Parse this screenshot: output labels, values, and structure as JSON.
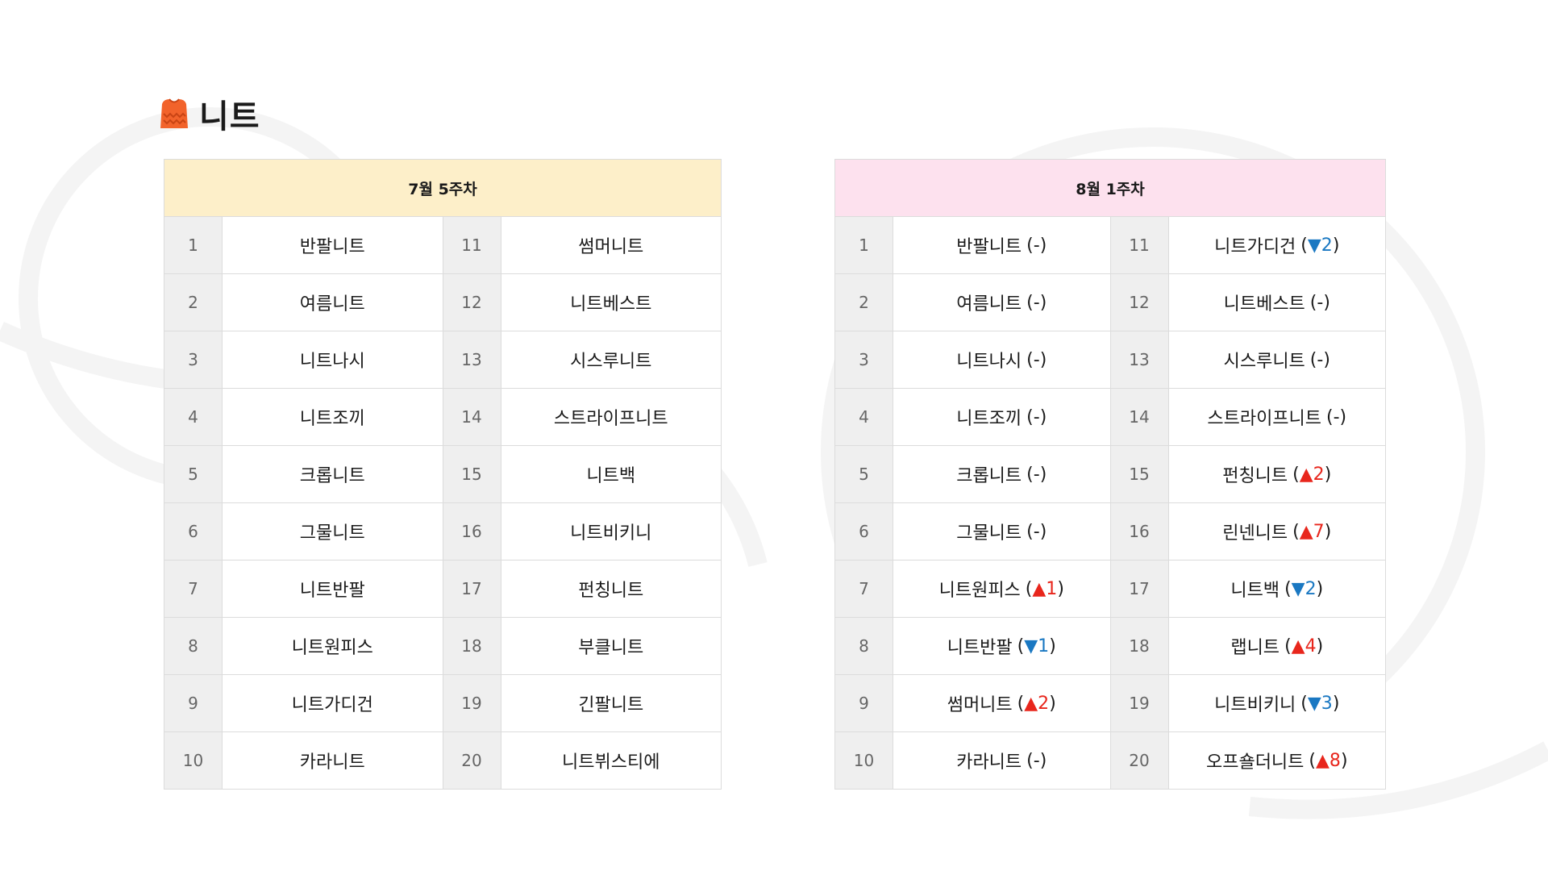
{
  "page": {
    "title": "니트",
    "icon": "sweater-icon",
    "colors": {
      "icon": "#f2632b",
      "up": "#e8261c",
      "down": "#1a78c2",
      "week1_header": "#fdefc9",
      "week2_header": "#fde1ee"
    }
  },
  "week1": {
    "header": "7월 5주차",
    "rows": [
      {
        "rank": "1",
        "name": "반팔니트",
        "rank2": "11",
        "name2": "썸머니트"
      },
      {
        "rank": "2",
        "name": "여름니트",
        "rank2": "12",
        "name2": "니트베스트"
      },
      {
        "rank": "3",
        "name": "니트나시",
        "rank2": "13",
        "name2": "시스루니트"
      },
      {
        "rank": "4",
        "name": "니트조끼",
        "rank2": "14",
        "name2": "스트라이프니트"
      },
      {
        "rank": "5",
        "name": "크롭니트",
        "rank2": "15",
        "name2": "니트백"
      },
      {
        "rank": "6",
        "name": "그물니트",
        "rank2": "16",
        "name2": "니트비키니"
      },
      {
        "rank": "7",
        "name": "니트반팔",
        "rank2": "17",
        "name2": "펀칭니트"
      },
      {
        "rank": "8",
        "name": "니트원피스",
        "rank2": "18",
        "name2": "부클니트"
      },
      {
        "rank": "9",
        "name": "니트가디건",
        "rank2": "19",
        "name2": "긴팔니트"
      },
      {
        "rank": "10",
        "name": "카라니트",
        "rank2": "20",
        "name2": "니트뷔스티에"
      }
    ]
  },
  "week2": {
    "header": "8월 1주차",
    "rows": [
      {
        "rank": "1",
        "name": "반팔니트",
        "change": "(-)",
        "dir": "none",
        "rank2": "11",
        "name2": "니트가디건",
        "change2": "▼2",
        "dir2": "down"
      },
      {
        "rank": "2",
        "name": "여름니트",
        "change": "(-)",
        "dir": "none",
        "rank2": "12",
        "name2": "니트베스트",
        "change2": "(-)",
        "dir2": "none"
      },
      {
        "rank": "3",
        "name": "니트나시",
        "change": "(-)",
        "dir": "none",
        "rank2": "13",
        "name2": "시스루니트",
        "change2": "(-)",
        "dir2": "none"
      },
      {
        "rank": "4",
        "name": "니트조끼",
        "change": "(-)",
        "dir": "none",
        "rank2": "14",
        "name2": "스트라이프니트",
        "change2": "(-)",
        "dir2": "none"
      },
      {
        "rank": "5",
        "name": "크롭니트",
        "change": "(-)",
        "dir": "none",
        "rank2": "15",
        "name2": "펀칭니트",
        "change2": "▲2",
        "dir2": "up"
      },
      {
        "rank": "6",
        "name": "그물니트",
        "change": "(-)",
        "dir": "none",
        "rank2": "16",
        "name2": "린넨니트",
        "change2": "▲7",
        "dir2": "up"
      },
      {
        "rank": "7",
        "name": "니트원피스",
        "change": "▲1",
        "dir": "up",
        "rank2": "17",
        "name2": "니트백",
        "change2": "▼2",
        "dir2": "down"
      },
      {
        "rank": "8",
        "name": "니트반팔",
        "change": "▼1",
        "dir": "down",
        "rank2": "18",
        "name2": "랩니트",
        "change2": "▲4",
        "dir2": "up"
      },
      {
        "rank": "9",
        "name": "썸머니트",
        "change": "▲2",
        "dir": "up",
        "rank2": "19",
        "name2": "니트비키니",
        "change2": "▼3",
        "dir2": "down"
      },
      {
        "rank": "10",
        "name": "카라니트",
        "change": "(-)",
        "dir": "none",
        "rank2": "20",
        "name2": "오프숄더니트",
        "change2": "▲8",
        "dir2": "up"
      }
    ]
  }
}
